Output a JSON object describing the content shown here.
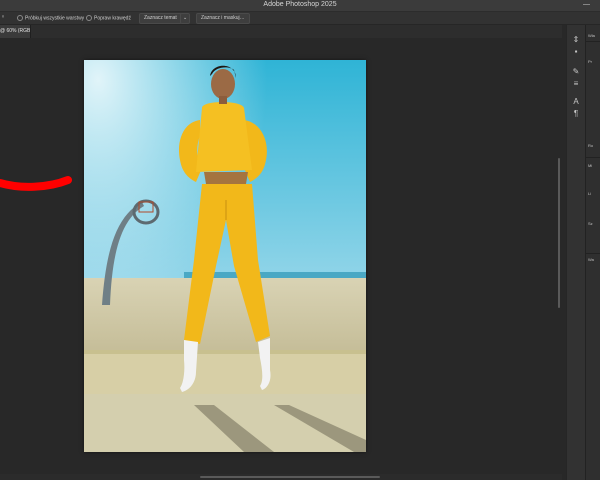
{
  "app": {
    "title": "Adobe Photoshop 2025",
    "minimize_glyph": "—"
  },
  "options_bar": {
    "sample_all_layers": "Próbkuj wszystkie warstwy",
    "hard_edge": "Popraw krawędź",
    "select_subject": "Zaznacz temat",
    "select_and_mask": "Zaznacz i maskuj…"
  },
  "document": {
    "tab_label": "@ 60% (RGB/8) *"
  },
  "tools": [
    "move-icon",
    "chat-icon",
    "brush-icon",
    "adjust-icon",
    "type-icon",
    "paragraph-icon"
  ],
  "panels": {
    "section_labels": [
      "Wła",
      "Pr",
      "Ro",
      "Mi",
      "Li",
      "Sz",
      "Wa"
    ]
  },
  "colors": {
    "brush_stroke": "#ff0000",
    "sky_top": "#2fb4d6",
    "outfit": "#f2b81a"
  }
}
